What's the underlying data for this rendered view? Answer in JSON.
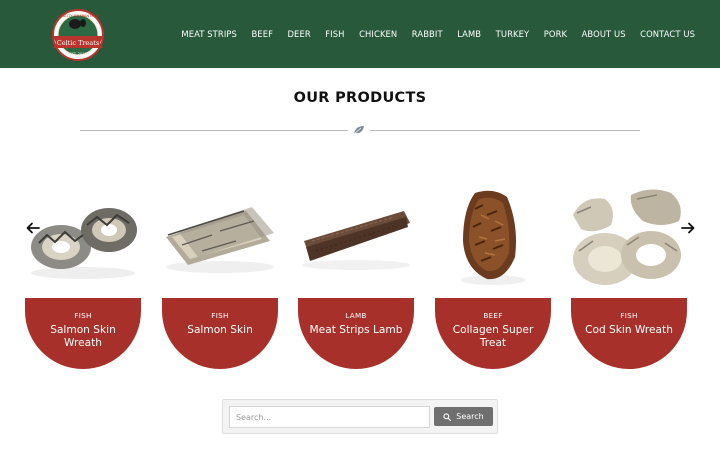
{
  "header": {
    "logo": {
      "icon": "celtic-treats-logo",
      "brand_text": "Celtic Treats",
      "ring_text": "QUALITY GUARANTEED",
      "est_text": "EST. 2017"
    },
    "nav": [
      {
        "label": "MEAT STRIPS"
      },
      {
        "label": "BEEF"
      },
      {
        "label": "DEER"
      },
      {
        "label": "FISH"
      },
      {
        "label": "CHICKEN"
      },
      {
        "label": "RABBIT"
      },
      {
        "label": "LAMB"
      },
      {
        "label": "TURKEY"
      },
      {
        "label": "PORK"
      },
      {
        "label": "ABOUT US"
      },
      {
        "label": "CONTACT US"
      }
    ]
  },
  "main": {
    "title": "OUR PRODUCTS",
    "divider_icon": "leaf-icon"
  },
  "carousel": {
    "prev_icon": "arrow-left-icon",
    "next_icon": "arrow-right-icon",
    "products": [
      {
        "category": "FISH",
        "name": "Salmon Skin Wreath",
        "image": "salmon-skin-wreath-image"
      },
      {
        "category": "FISH",
        "name": "Salmon Skin",
        "image": "salmon-skin-image"
      },
      {
        "category": "LAMB",
        "name": "Meat Strips Lamb",
        "image": "lamb-meat-strips-image"
      },
      {
        "category": "BEEF",
        "name": "Collagen Super Treat",
        "image": "collagen-treat-image"
      },
      {
        "category": "FISH",
        "name": "Cod Skin Wreath",
        "image": "cod-skin-wreath-image"
      }
    ]
  },
  "search": {
    "placeholder": "Search...",
    "value": "",
    "button_label": "Search",
    "button_icon": "search-icon"
  },
  "colors": {
    "header_bg": "#27593a",
    "card_bg": "#a8302a",
    "search_button": "#6f6f6f"
  }
}
